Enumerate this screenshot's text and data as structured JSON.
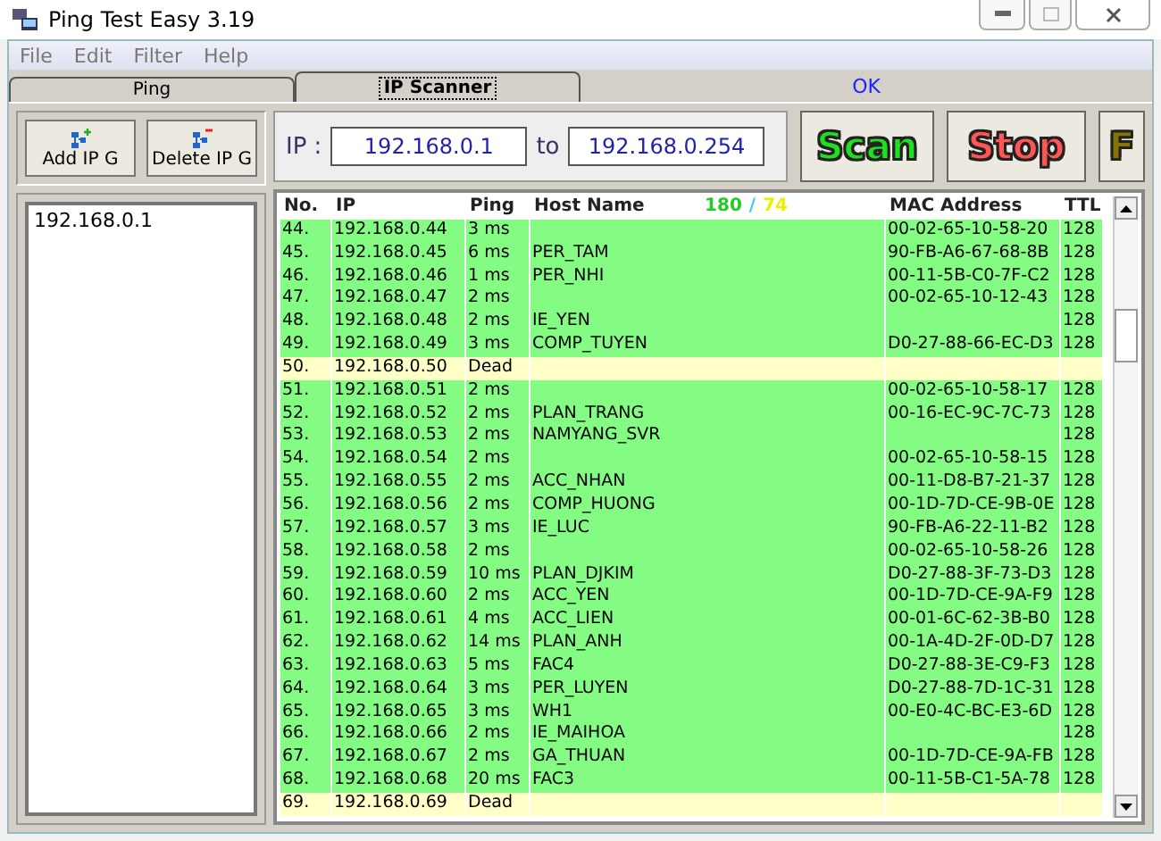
{
  "window": {
    "title": "Ping Test Easy 3.19"
  },
  "menu": [
    "File",
    "Edit",
    "Filter",
    "Help"
  ],
  "tabs": [
    {
      "label": "Ping",
      "selected": false
    },
    {
      "label": "IP Scanner",
      "selected": true
    }
  ],
  "status": "OK",
  "sidebar": {
    "buttons": [
      {
        "label": "Add  IP G",
        "kind": "add"
      },
      {
        "label": "Delete IP G",
        "kind": "delete"
      }
    ],
    "items": [
      "192.168.0.1"
    ]
  },
  "range": {
    "label": "IP :",
    "from": "192.168.0.1",
    "to_label": "to",
    "to": "192.168.0.254"
  },
  "actions": [
    {
      "label": "Scan",
      "kind": "scan"
    },
    {
      "label": "Stop",
      "kind": "stop"
    },
    {
      "label": "F",
      "kind": "filter"
    }
  ],
  "table": {
    "columns": [
      "No.",
      "IP",
      "Ping",
      "Host Name",
      "MAC Address",
      "TTL"
    ],
    "alive_count": "180",
    "separator": "/",
    "dead_count": "74",
    "rows": [
      {
        "no": "44.",
        "ip": "192.168.0.44",
        "ping": "3 ms",
        "host": "",
        "mac": "00-02-65-10-58-20",
        "ttl": "128",
        "kind": "alive"
      },
      {
        "no": "45.",
        "ip": "192.168.0.45",
        "ping": "6 ms",
        "host": "PER_TAM",
        "mac": "90-FB-A6-67-68-8B",
        "ttl": "128",
        "kind": "alive"
      },
      {
        "no": "46.",
        "ip": "192.168.0.46",
        "ping": "1 ms",
        "host": "PER_NHI",
        "mac": "00-11-5B-C0-7F-C2",
        "ttl": "128",
        "kind": "alive"
      },
      {
        "no": "47.",
        "ip": "192.168.0.47",
        "ping": "2 ms",
        "host": "",
        "mac": "00-02-65-10-12-43",
        "ttl": "128",
        "kind": "alive"
      },
      {
        "no": "48.",
        "ip": "192.168.0.48",
        "ping": "2 ms",
        "host": "IE_YEN",
        "mac": "",
        "ttl": "128",
        "kind": "alive"
      },
      {
        "no": "49.",
        "ip": "192.168.0.49",
        "ping": "3 ms",
        "host": "COMP_TUYEN",
        "mac": "D0-27-88-66-EC-D3",
        "ttl": "128",
        "kind": "alive"
      },
      {
        "no": "50.",
        "ip": "192.168.0.50",
        "ping": "Dead",
        "host": "",
        "mac": "",
        "ttl": "",
        "kind": "dead"
      },
      {
        "no": "51.",
        "ip": "192.168.0.51",
        "ping": "2 ms",
        "host": "",
        "mac": "00-02-65-10-58-17",
        "ttl": "128",
        "kind": "alive"
      },
      {
        "no": "52.",
        "ip": "192.168.0.52",
        "ping": "2 ms",
        "host": "PLAN_TRANG",
        "mac": "00-16-EC-9C-7C-73",
        "ttl": "128",
        "kind": "alive"
      },
      {
        "no": "53.",
        "ip": "192.168.0.53",
        "ping": "2 ms",
        "host": "NAMYANG_SVR",
        "mac": "",
        "ttl": "128",
        "kind": "alive"
      },
      {
        "no": "54.",
        "ip": "192.168.0.54",
        "ping": "2 ms",
        "host": "",
        "mac": "00-02-65-10-58-15",
        "ttl": "128",
        "kind": "alive"
      },
      {
        "no": "55.",
        "ip": "192.168.0.55",
        "ping": "2 ms",
        "host": "ACC_NHAN",
        "mac": "00-11-D8-B7-21-37",
        "ttl": "128",
        "kind": "alive"
      },
      {
        "no": "56.",
        "ip": "192.168.0.56",
        "ping": "2 ms",
        "host": "COMP_HUONG",
        "mac": "00-1D-7D-CE-9B-0E",
        "ttl": "128",
        "kind": "alive"
      },
      {
        "no": "57.",
        "ip": "192.168.0.57",
        "ping": "3 ms",
        "host": "IE_LUC",
        "mac": "90-FB-A6-22-11-B2",
        "ttl": "128",
        "kind": "alive"
      },
      {
        "no": "58.",
        "ip": "192.168.0.58",
        "ping": "2 ms",
        "host": "",
        "mac": "00-02-65-10-58-26",
        "ttl": "128",
        "kind": "alive"
      },
      {
        "no": "59.",
        "ip": "192.168.0.59",
        "ping": "10 ms",
        "host": "PLAN_DJKIM",
        "mac": "D0-27-88-3F-73-D3",
        "ttl": "128",
        "kind": "alive"
      },
      {
        "no": "60.",
        "ip": "192.168.0.60",
        "ping": "2 ms",
        "host": "ACC_YEN",
        "mac": "00-1D-7D-CE-9A-F9",
        "ttl": "128",
        "kind": "alive"
      },
      {
        "no": "61.",
        "ip": "192.168.0.61",
        "ping": "4 ms",
        "host": "ACC_LIEN",
        "mac": "00-01-6C-62-3B-B0",
        "ttl": "128",
        "kind": "alive"
      },
      {
        "no": "62.",
        "ip": "192.168.0.62",
        "ping": "14 ms",
        "host": "PLAN_ANH",
        "mac": "00-1A-4D-2F-0D-D7",
        "ttl": "128",
        "kind": "alive"
      },
      {
        "no": "63.",
        "ip": "192.168.0.63",
        "ping": "5 ms",
        "host": "FAC4",
        "mac": "D0-27-88-3E-C9-F3",
        "ttl": "128",
        "kind": "alive"
      },
      {
        "no": "64.",
        "ip": "192.168.0.64",
        "ping": "3 ms",
        "host": "PER_LUYEN",
        "mac": "D0-27-88-7D-1C-31",
        "ttl": "128",
        "kind": "alive"
      },
      {
        "no": "65.",
        "ip": "192.168.0.65",
        "ping": "3 ms",
        "host": "WH1",
        "mac": "00-E0-4C-BC-E3-6D",
        "ttl": "128",
        "kind": "alive"
      },
      {
        "no": "66.",
        "ip": "192.168.0.66",
        "ping": "2 ms",
        "host": "IE_MAIHOA",
        "mac": "",
        "ttl": "128",
        "kind": "alive"
      },
      {
        "no": "67.",
        "ip": "192.168.0.67",
        "ping": "2 ms",
        "host": "GA_THUAN",
        "mac": "00-1D-7D-CE-9A-FB",
        "ttl": "128",
        "kind": "alive"
      },
      {
        "no": "68.",
        "ip": "192.168.0.68",
        "ping": "20 ms",
        "host": "FAC3",
        "mac": "00-11-5B-C1-5A-78",
        "ttl": "128",
        "kind": "alive"
      },
      {
        "no": "69.",
        "ip": "192.168.0.69",
        "ping": "Dead",
        "host": "",
        "mac": "",
        "ttl": "",
        "kind": "dead"
      }
    ]
  }
}
